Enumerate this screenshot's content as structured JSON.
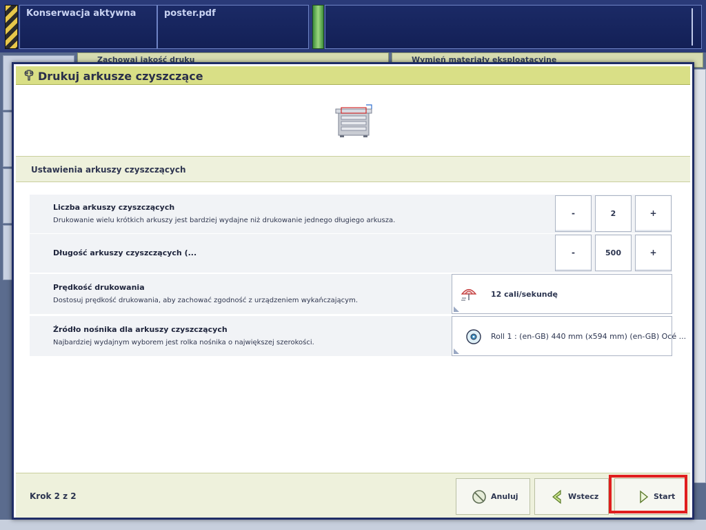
{
  "status_bar": {
    "status_text": "Konserwacja aktywna",
    "job_name": "poster.pdf"
  },
  "background": {
    "panel_left_title": "Zachowaj jakość druku",
    "panel_right_title": "Wymień materiały eksploatacyjne"
  },
  "dialog": {
    "title": "Drukuj arkusze czyszczące",
    "section_title": "Ustawienia arkuszy czyszczących",
    "rows": [
      {
        "title": "Liczba arkuszy czyszczących",
        "description": "Drukowanie wielu krótkich arkuszy jest bardziej wydajne niż drukowanie jednego długiego arkusza.",
        "minus": "-",
        "value": "2",
        "plus": "+"
      },
      {
        "title": "Długość arkuszy czyszczących (...",
        "minus": "-",
        "value": "500",
        "plus": "+"
      },
      {
        "title": "Prędkość drukowania",
        "description": "Dostosuj prędkość drukowania, aby zachować zgodność z urządzeniem wykańczającym.",
        "selected": "12 cali/sekundę",
        "icon": "umbrella-speed-icon"
      },
      {
        "title": "Źródło nośnika dla arkuszy czyszczących",
        "description": "Najbardziej wydajnym wyborem jest rolka nośnika o największej szerokości.",
        "selected": "Roll 1 : (en-GB) 440 mm (x594 mm) (en-GB) Océ ...",
        "icon": "media-roll-icon"
      }
    ],
    "footer": {
      "step": "Krok 2 z 2",
      "cancel_label": "Anuluj",
      "back_label": "Wstecz",
      "start_label": "Start"
    }
  },
  "colors": {
    "header_accent": "#d9df86",
    "highlight": "#e01e1e",
    "topbar": "#2a3a78"
  }
}
